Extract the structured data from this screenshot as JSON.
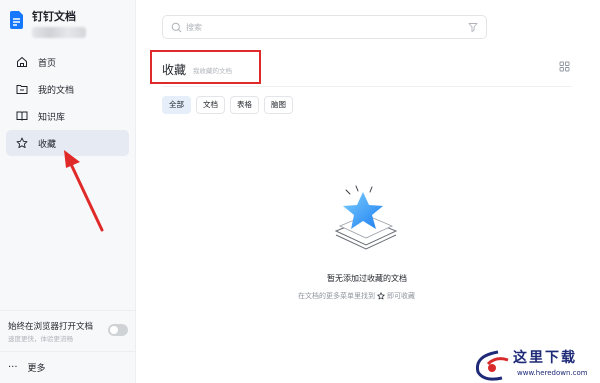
{
  "app": {
    "title": "钉钉文档"
  },
  "sidebar": {
    "items": [
      {
        "label": "首页",
        "icon": "home-icon"
      },
      {
        "label": "我的文档",
        "icon": "folder-icon"
      },
      {
        "label": "知识库",
        "icon": "book-icon"
      },
      {
        "label": "收藏",
        "icon": "star-icon",
        "active": true
      }
    ],
    "browser_title": "始终在浏览器打开文档",
    "browser_sub": "速度更快，体验更流畅",
    "browser_toggle_on": false,
    "more_dots": "···",
    "more_label": "更多"
  },
  "search": {
    "placeholder": "搜索"
  },
  "page": {
    "title": "收藏",
    "subtitle": "我收藏的文档"
  },
  "filters": [
    "全部",
    "文档",
    "表格",
    "脑图"
  ],
  "active_filter": "全部",
  "empty": {
    "title": "暂无添加过收藏的文档",
    "hint_before": "在文档的更多菜单里找到",
    "hint_after": "即可收藏"
  },
  "watermark": {
    "text": "这里下载",
    "url": "www.heredown.com"
  },
  "colors": {
    "accent": "#1677ff",
    "highlight_box": "#e02a2a",
    "active_bg": "#e5eaf3"
  }
}
